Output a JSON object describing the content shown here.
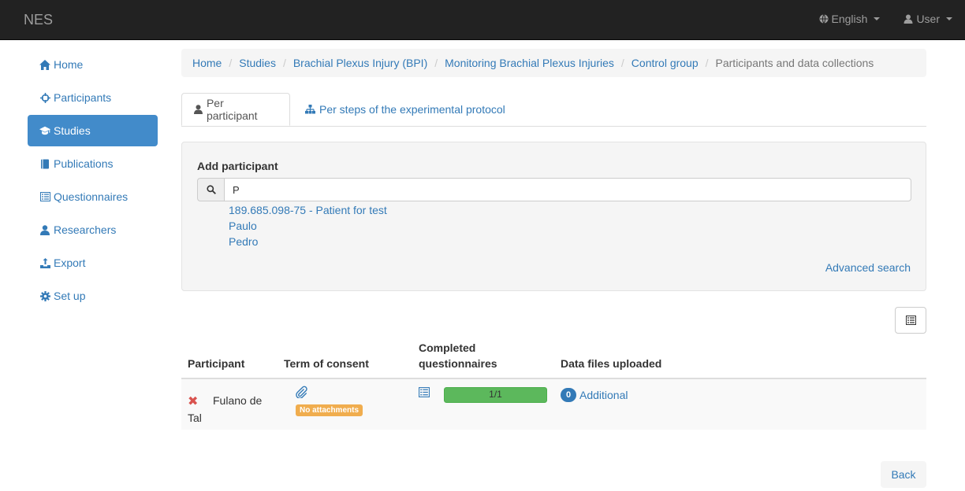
{
  "navbar": {
    "brand": "NES",
    "language_label": "English",
    "user_label": "User"
  },
  "sidebar": {
    "items": [
      {
        "label": "Home",
        "icon": "home-icon"
      },
      {
        "label": "Participants",
        "icon": "crosshair-icon"
      },
      {
        "label": "Studies",
        "icon": "graduation-cap-icon"
      },
      {
        "label": "Publications",
        "icon": "book-icon"
      },
      {
        "label": "Questionnaires",
        "icon": "list-alt-icon"
      },
      {
        "label": "Researchers",
        "icon": "user-icon"
      },
      {
        "label": "Export",
        "icon": "export-icon"
      },
      {
        "label": "Set up",
        "icon": "cog-icon"
      }
    ],
    "active_index": 2
  },
  "breadcrumb": {
    "items": [
      "Home",
      "Studies",
      "Brachial Plexus Injury (BPI)",
      "Monitoring Brachial Plexus Injuries",
      "Control group"
    ],
    "current": "Participants and data collections"
  },
  "tabs": {
    "per_participant": "Per participant",
    "per_steps": "Per steps of the experimental protocol"
  },
  "add_participant": {
    "label": "Add participant",
    "search_value": "P",
    "suggestions": [
      "189.685.098-75 - Patient for test",
      "Paulo",
      "Pedro"
    ],
    "advanced_search": "Advanced search"
  },
  "table": {
    "headers": {
      "participant": "Participant",
      "consent": "Term of consent",
      "questionnaires_line1": "Completed",
      "questionnaires_line2": "questionnaires",
      "data_files": "Data files uploaded"
    },
    "rows": [
      {
        "participant": "Fulano de Tal",
        "consent_badge": "No attachments",
        "questionnaire_progress": "1/1",
        "progress_fraction": 1.0,
        "data_files_count": "0",
        "data_files_label": "Additional"
      }
    ]
  },
  "back_button": "Back",
  "colors": {
    "navbar_bg": "#222222",
    "link": "#337ab7",
    "active": "#428bca",
    "success": "#5cb85c",
    "warning": "#f0ad4e",
    "danger": "#d9534f"
  }
}
